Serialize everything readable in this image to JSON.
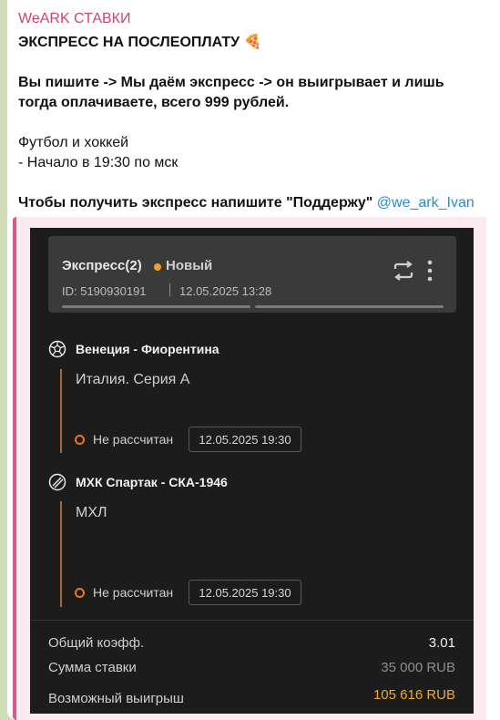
{
  "message": {
    "sender": "WeARK СТАВКИ",
    "headline": "ЭКСПРЕСС НА ПОСЛЕОПЛАТУ",
    "headline_emoji": "🍕",
    "paragraph_line1": "Вы пишите -> Мы даём экспресс -> он выигрывает и лишь",
    "paragraph_line2": "тогда оплачиваете, всего 999 рублей.",
    "sports_line": "Футбол и хоккей",
    "start_line": "- Начало в 19:30 по мск",
    "cta_text": "Чтобы получить экспресс напишите \"Поддержу\" ",
    "cta_mention": "@we_ark_Ivan"
  },
  "bet_card": {
    "title": "Экспресс(2)",
    "status": "Новый",
    "id_text": "ID: 5190930191",
    "date_text": "12.05.2025 13:28",
    "icons": {
      "swap": "swap-arrows-icon",
      "more": "more-vertical-icon"
    },
    "events": [
      {
        "icon": "soccer-ball-icon",
        "name": "Венеция - Фиорентина",
        "league": "Италия. Серия А",
        "status": "Не рассчитан",
        "time": "12.05.2025 19:30"
      },
      {
        "icon": "hockey-puck-icon",
        "name": "МХК Спартак - СКА-1946",
        "league": "МХЛ",
        "status": "Не рассчитан",
        "time": "12.05.2025 19:30"
      }
    ],
    "summary": {
      "coef_label": "Общий коэфф.",
      "coef_value": "3.01",
      "stake_label": "Сумма ставки",
      "stake_value": "35 000 RUB",
      "win_label": "Возможный выигрыш",
      "win_value": "105 616 RUB"
    }
  },
  "colors": {
    "sender": "#c8457a",
    "mention": "#2a8bd0",
    "status_dot": "#f39c2b",
    "win_value": "#f0a830"
  }
}
